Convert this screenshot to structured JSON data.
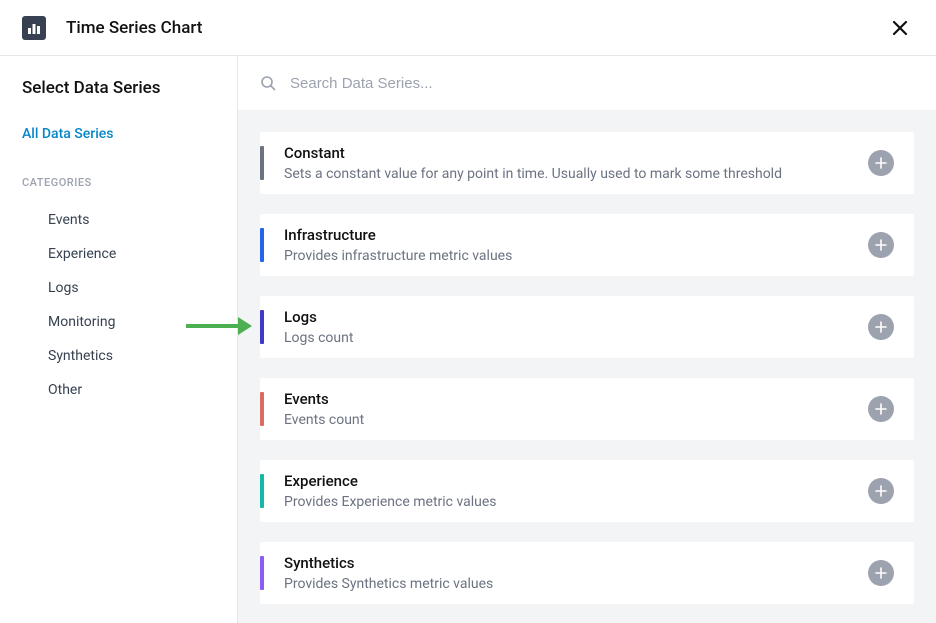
{
  "header": {
    "title": "Time Series Chart"
  },
  "sidebar": {
    "title": "Select Data Series",
    "allLink": "All Data Series",
    "categoriesLabel": "CATEGORIES",
    "categories": [
      "Events",
      "Experience",
      "Logs",
      "Monitoring",
      "Synthetics",
      "Other"
    ]
  },
  "search": {
    "placeholder": "Search Data Series..."
  },
  "cards": [
    {
      "title": "Constant",
      "desc": "Sets a constant value for any point in time. Usually used to mark some threshold",
      "color": "#6b7280"
    },
    {
      "title": "Infrastructure",
      "desc": "Provides infrastructure metric values",
      "color": "#2563eb"
    },
    {
      "title": "Logs",
      "desc": "Logs count",
      "color": "#4338ca"
    },
    {
      "title": "Events",
      "desc": "Events count",
      "color": "#dc6b5f"
    },
    {
      "title": "Experience",
      "desc": "Provides Experience metric values",
      "color": "#14b8a6"
    },
    {
      "title": "Synthetics",
      "desc": "Provides Synthetics metric values",
      "color": "#8b5cf6"
    }
  ]
}
